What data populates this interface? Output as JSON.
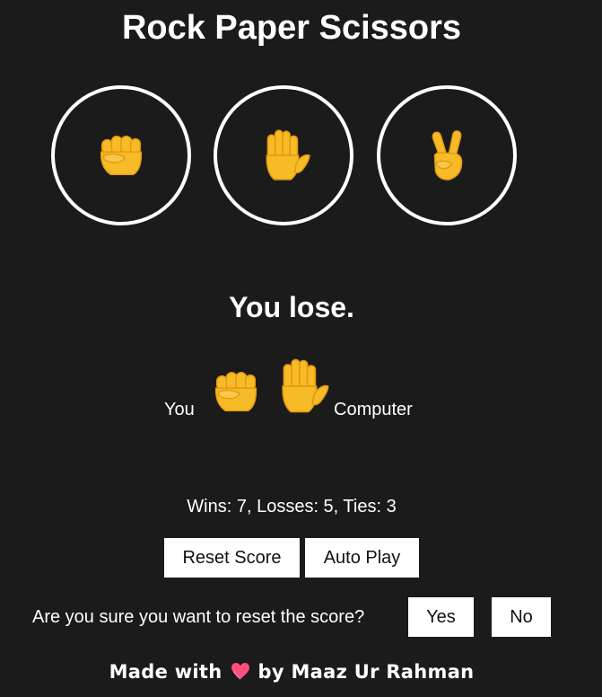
{
  "app": {
    "title": "Rock Paper Scissors"
  },
  "moves": [
    {
      "name": "Rock",
      "icon": "fist-emoji"
    },
    {
      "name": "Paper",
      "icon": "hand-emoji"
    },
    {
      "name": "Scissors",
      "icon": "victory-hand-emoji"
    }
  ],
  "result": {
    "text": "You lose."
  },
  "last_moves": {
    "you_label": "You",
    "you_move_icon": "fist-emoji",
    "computer_move_icon": "hand-emoji",
    "computer_label": "Computer"
  },
  "score": {
    "text": "Wins: 7, Losses: 5, Ties: 3",
    "wins": 7,
    "losses": 5,
    "ties": 3
  },
  "controls": {
    "reset_label": "Reset Score",
    "auto_play_label": "Auto Play"
  },
  "confirm": {
    "question": "Are you sure you want to reset the score?",
    "yes_label": "Yes",
    "no_label": "No"
  },
  "footer": {
    "prefix": "Made with",
    "suffix": "by Maaz Ur Rahman",
    "heart_icon": "heart-icon"
  },
  "colors": {
    "background": "#1b1b1b",
    "text": "#ffffff",
    "emoji_yellow": "#f6bb27",
    "heart": "#ff4d7d"
  }
}
